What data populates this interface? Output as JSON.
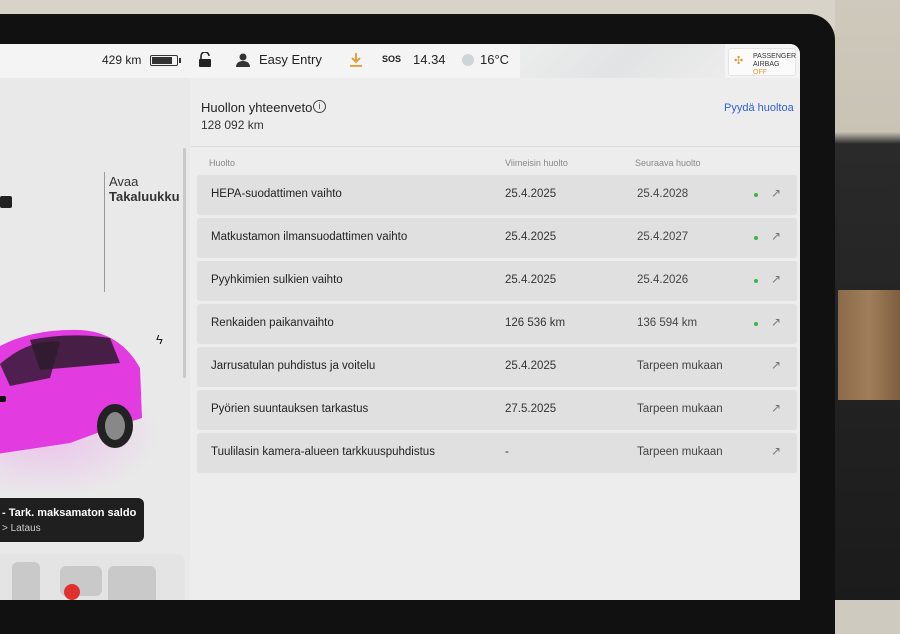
{
  "status_bar": {
    "range": "429 km",
    "battery_level": 0.85,
    "profile": "Easy Entry",
    "sos": "SOS",
    "time": "14.34",
    "temperature": "16°C",
    "airbag": {
      "line1": "PASSENGER",
      "line2a": "AIRBAG ",
      "line2b": "OFF"
    }
  },
  "car_panel": {
    "trunk_line1": "Avaa",
    "trunk_line2": "Takaluukku",
    "alert_title": "- Tark. maksamaton saldo",
    "alert_link": "> Lataus",
    "car_color": "#e23be0"
  },
  "main": {
    "title": "Huollon yhteenveto",
    "info": "i",
    "odometer": "128 092  km",
    "request_link": "Pyydä huoltoa",
    "columns": {
      "service": "Huolto",
      "last": "Viimeisin huolto",
      "next": "Seuraava huolto"
    },
    "rows": [
      {
        "name": "HEPA-suodattimen vaihto",
        "last": "25.4.2025",
        "next": "25.4.2028",
        "ok": true
      },
      {
        "name": "Matkustamon ilmansuodattimen vaihto",
        "last": "25.4.2025",
        "next": "25.4.2027",
        "ok": true
      },
      {
        "name": "Pyyhkimien sulkien vaihto",
        "last": "25.4.2025",
        "next": "25.4.2026",
        "ok": true
      },
      {
        "name": "Renkaiden paikanvaihto",
        "last": "126 536 km",
        "next": "136 594 km",
        "ok": true
      },
      {
        "name": "Jarrusatulan puhdistus ja voitelu",
        "last": "25.4.2025",
        "next": "Tarpeen mukaan",
        "ok": false
      },
      {
        "name": "Pyörien suuntauksen tarkastus",
        "last": "27.5.2025",
        "next": "Tarpeen mukaan",
        "ok": false
      },
      {
        "name": "Tuulilasin kamera-alueen tarkkuuspuhdistus",
        "last": "-",
        "next": "Tarpeen mukaan",
        "ok": false
      }
    ],
    "arrow_glyph": "↗"
  },
  "colors": {
    "accent_link": "#2f5fd8",
    "status_ok": "#3cb44b"
  }
}
